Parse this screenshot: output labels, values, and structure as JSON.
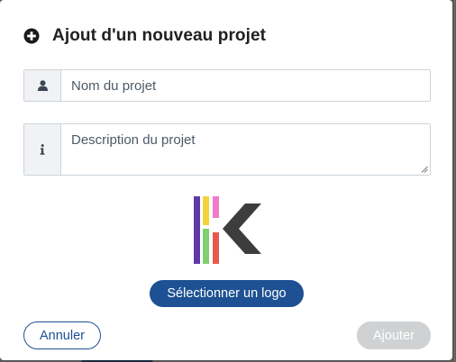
{
  "dialog": {
    "title": "Ajout d'un nouveau projet",
    "header_icon": "plus-circle-icon"
  },
  "form": {
    "name": {
      "icon": "user-icon",
      "placeholder": "Nom du projet",
      "value": ""
    },
    "description": {
      "icon": "info-icon",
      "placeholder": "Description du projet",
      "value": ""
    }
  },
  "logo": {
    "icon": "k-logo",
    "colors": {
      "bar_purple": "#5e3aa6",
      "bar_yellow": "#f3d43c",
      "bar_pink": "#f27ac8",
      "bar_green": "#7ed06e",
      "bar_red": "#e65a4e",
      "chevron": "#3d3d3d"
    }
  },
  "buttons": {
    "select_logo": "Sélectionner un logo",
    "cancel": "Annuler",
    "add": "Ajouter"
  },
  "colors": {
    "primary": "#1d5193",
    "disabled": "#cfd1d3",
    "addon_bg": "#f0f2f4",
    "border": "#ccd3da"
  }
}
